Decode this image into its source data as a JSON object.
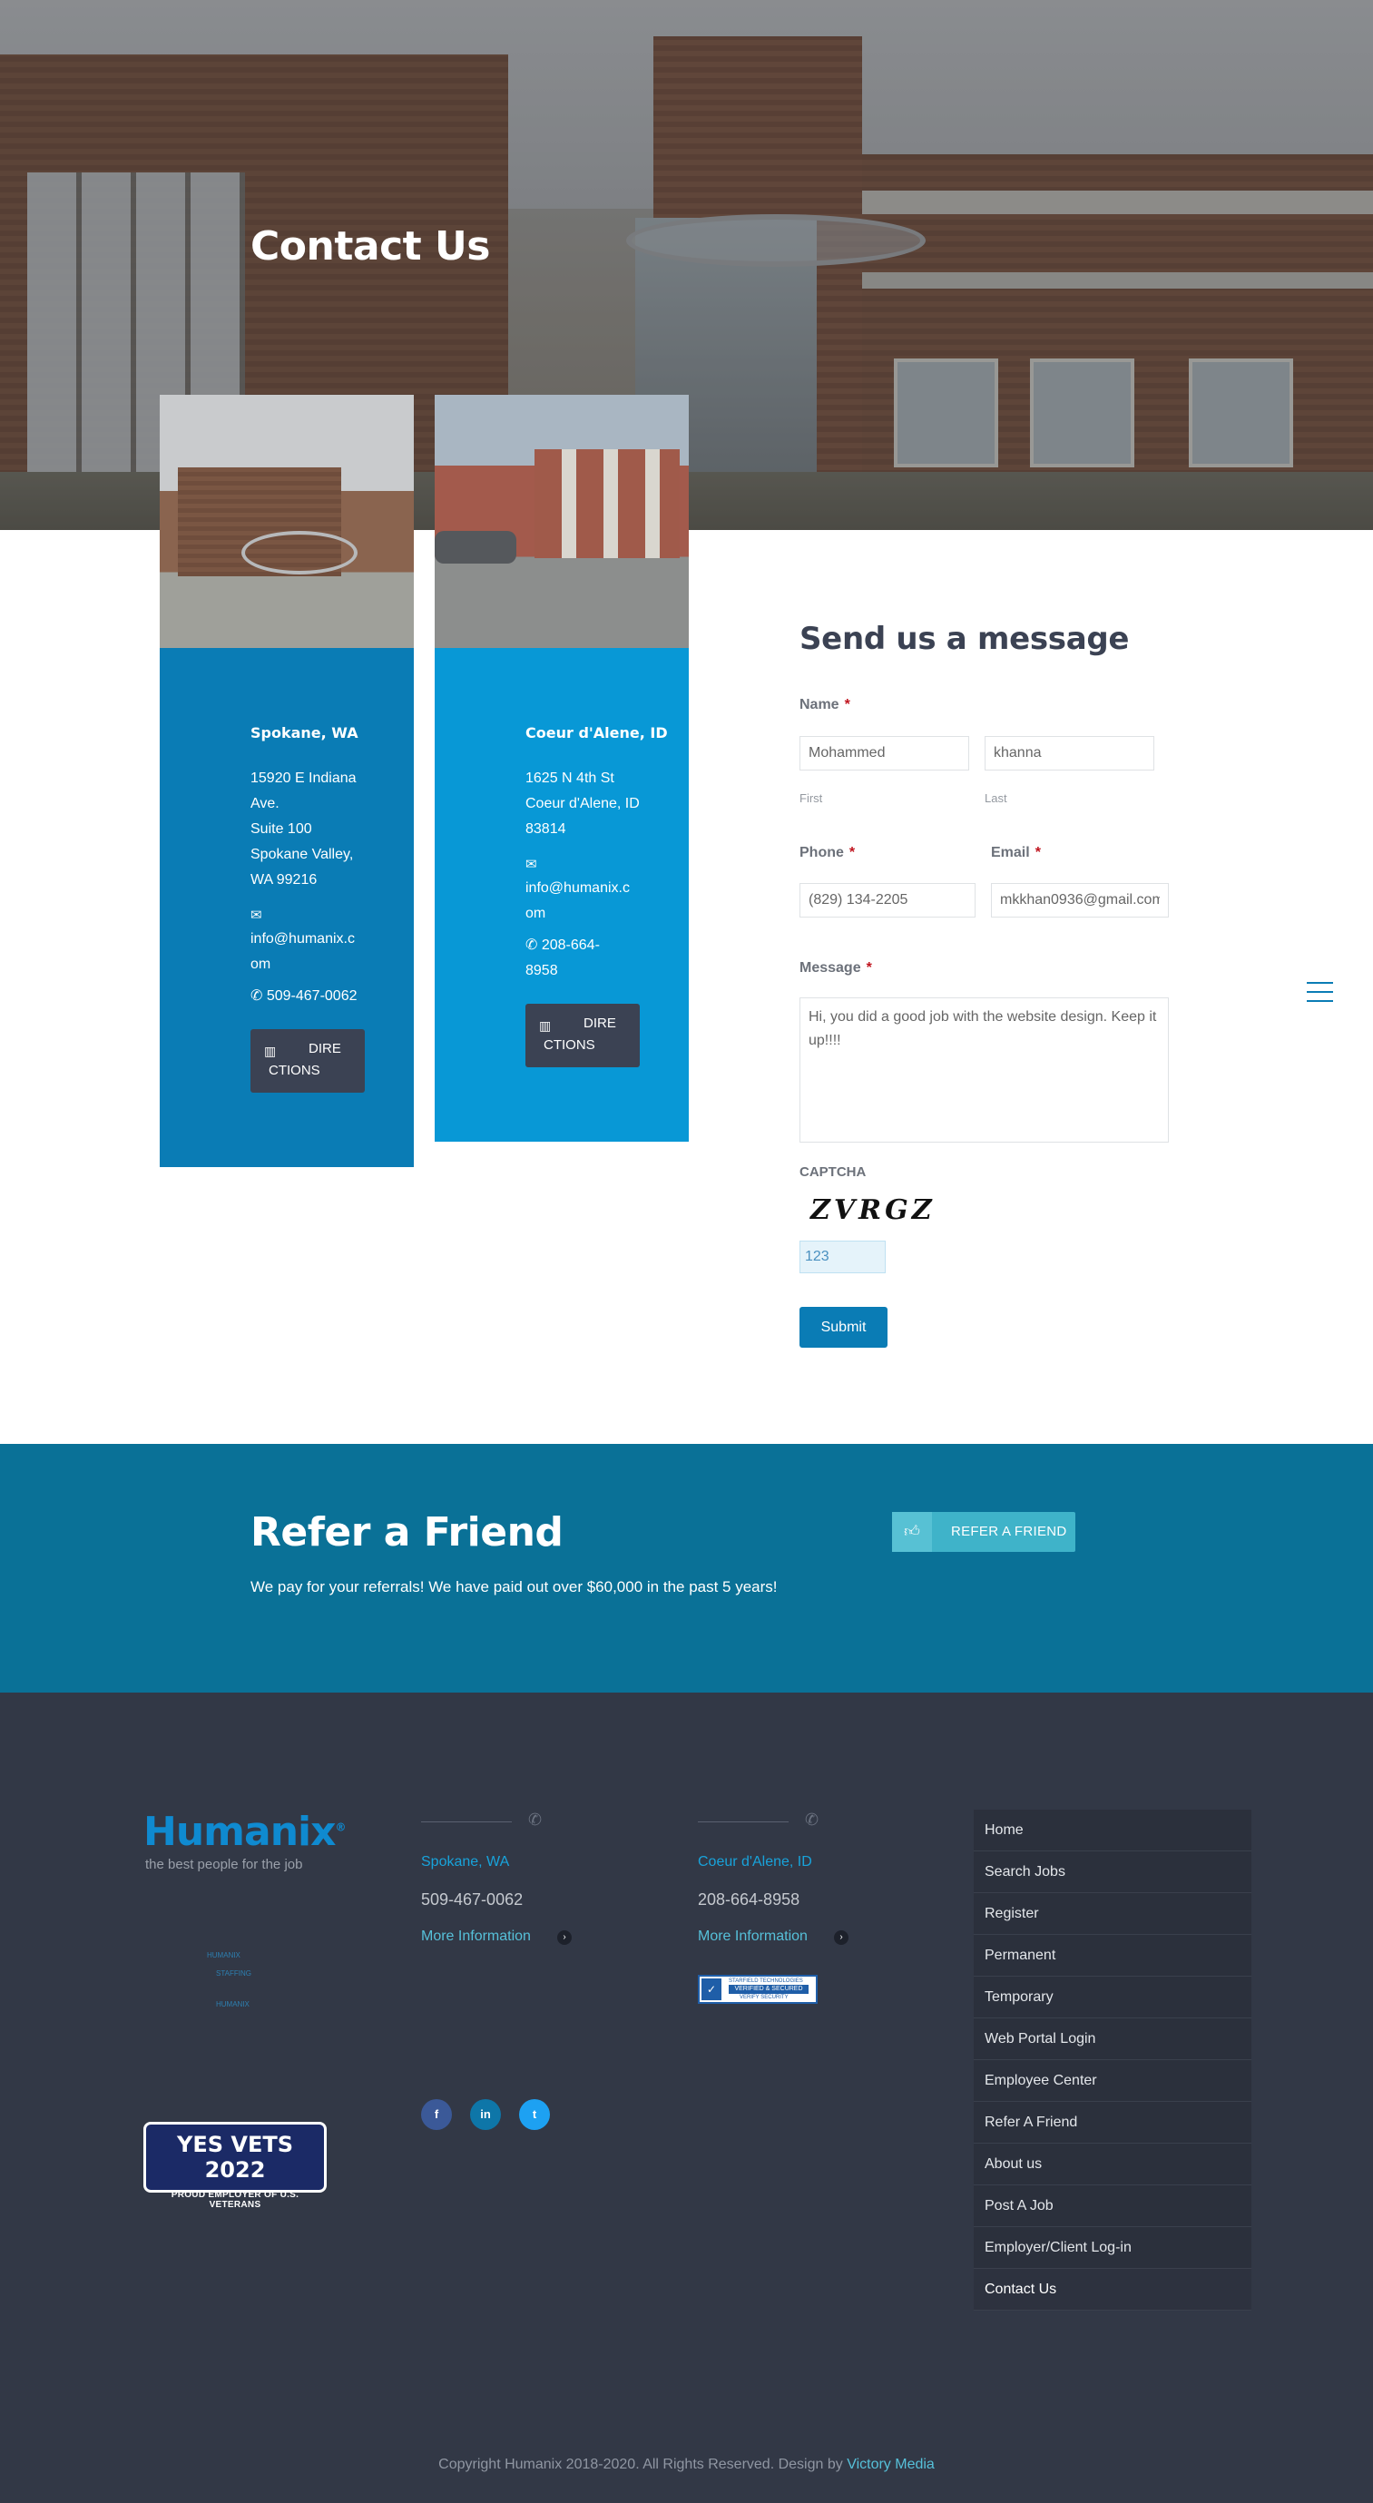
{
  "hero": {
    "title": "Contact Us"
  },
  "locations": [
    {
      "city": "Spokane, WA",
      "address": [
        "15920 E Indiana",
        "Ave.",
        "Suite 100",
        "Spokane Valley,",
        "WA 99216"
      ],
      "email": [
        "info@humanix.c",
        "om"
      ],
      "phone": "509-467-0062",
      "directions": [
        "DIRE",
        "CTIONS"
      ]
    },
    {
      "city": "Coeur d'Alene, ID",
      "address": [
        "1625 N 4th St",
        "Coeur d'Alene, ID",
        "83814"
      ],
      "email": [
        "info@humanix.c",
        "om"
      ],
      "phone": [
        "208-664-",
        "8958"
      ],
      "directions": [
        "DIRE",
        "CTIONS"
      ]
    }
  ],
  "form": {
    "title": "Send us a message",
    "name_label": "Name",
    "first_value": "Mohammed",
    "last_value": "khanna",
    "first_sub": "First",
    "last_sub": "Last",
    "phone_label": "Phone",
    "phone_value": "(829) 134-2205",
    "email_label": "Email",
    "email_value": "mkkhan0936@gmail.com",
    "message_label": "Message",
    "message_value": "Hi, you did a good job with the website design. Keep it up!!!!",
    "captcha_label": "CAPTCHA",
    "captcha_image_text": "ZVRGZ",
    "captcha_value": "123",
    "required_mark": "*",
    "submit_label": "Submit"
  },
  "refer": {
    "title": "Refer a Friend",
    "text": "We pay for your referrals! We have paid out over $60,000 in the past 5 years!",
    "button_label": "REFER A FRIEND"
  },
  "footer": {
    "logo_text": "Humanix",
    "logo_mark": "®",
    "tagline": "the best people for the job",
    "small_logos": [
      "HUMANIX",
      "STAFFING",
      "HUMANIX"
    ],
    "yesvets_title": "YES VETS 2022",
    "yesvets_sub": "PROUD EMPLOYER OF U.S. VETERANS",
    "offices": [
      {
        "city": "Spokane, WA",
        "phone": "509-467-0062",
        "more": "More Information"
      },
      {
        "city": "Coeur d'Alene, ID",
        "phone": "208-664-8958",
        "more": "More Information"
      }
    ],
    "social": [
      "f",
      "in",
      "t"
    ],
    "secured_badge": [
      "STARFIELD TECHNOLOGIES",
      "VERIFIED & SECURED",
      "VERIFY SECURITY"
    ],
    "menu": [
      "Home",
      "Search Jobs",
      "Register",
      "Permanent",
      "Temporary",
      "Web Portal Login",
      "Employee Center",
      "Refer A Friend",
      "About us",
      "Post A Job",
      "Employer/Client Log-in",
      "Contact Us"
    ],
    "copyright": "Copyright Humanix 2018-2020. All Rights Reserved. Design by",
    "designer": "Victory Media"
  },
  "colors": {
    "primary": "#0a7cb5",
    "card_alt": "#0898d6",
    "refer_bg": "#0a7197",
    "footer_bg": "#323846",
    "accent": "#56c0d9"
  }
}
